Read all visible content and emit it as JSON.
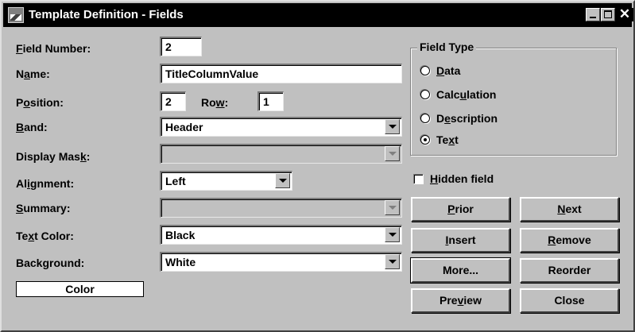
{
  "window": {
    "title": "Template Definition - Fields",
    "controls": {
      "minimize": "_",
      "maximize": "□",
      "close": "✕"
    }
  },
  "labels": {
    "field_number": "Field Number:",
    "name": "Name:",
    "position": "Position:",
    "row": "Row:",
    "band": "Band:",
    "display_mask": "Display Mask:",
    "alignment": "Alignment:",
    "summary": "Summary:",
    "text_color": "Text Color:",
    "background": "Background:"
  },
  "values": {
    "field_number": "2",
    "name": "TitleColumnValue",
    "position": "2",
    "row": "1",
    "band": "Header",
    "display_mask": "",
    "alignment": "Left",
    "summary": "",
    "text_color": "Black",
    "background": "White"
  },
  "field_type": {
    "title": "Field Type",
    "options": [
      "Data",
      "Calculation",
      "Description",
      "Text"
    ],
    "selected": "Text"
  },
  "hidden_field": {
    "label": "Hidden field",
    "checked": false
  },
  "buttons": {
    "prior": "Prior",
    "next": "Next",
    "insert": "Insert",
    "remove": "Remove",
    "more": "More...",
    "reorder": "Reorder",
    "preview": "Preview",
    "close": "Close"
  },
  "color_sample": "Color"
}
